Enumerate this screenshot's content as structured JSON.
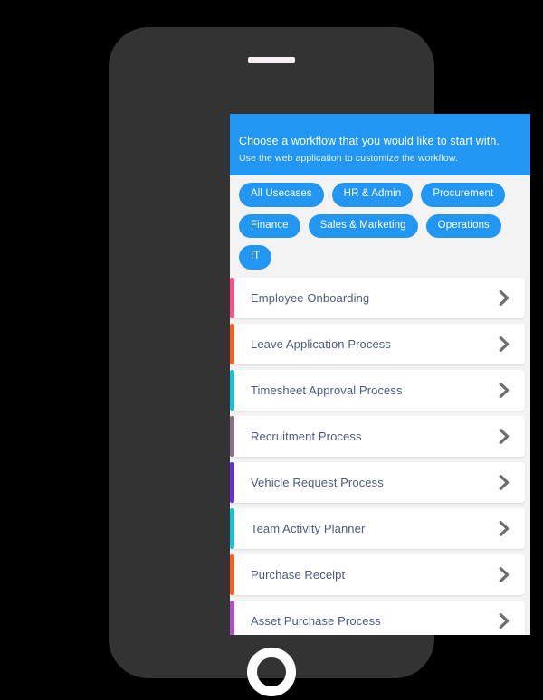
{
  "device": {
    "frame_color": "#333333",
    "speaker_slot_color": "#f7eef3",
    "home_button_color": "#ffffff"
  },
  "header": {
    "title": "Choose a workflow that you would like to start with.",
    "subtitle": "Use the web application to customize the workflow.",
    "background": "#2196f3"
  },
  "filters": {
    "chips": [
      {
        "label": "All Usecases"
      },
      {
        "label": "HR & Admin"
      },
      {
        "label": "Procurement"
      },
      {
        "label": "Finance"
      },
      {
        "label": "Sales & Marketing"
      },
      {
        "label": "Operations"
      },
      {
        "label": "IT"
      }
    ],
    "chip_color": "#2196f3"
  },
  "workflows": {
    "items": [
      {
        "label": "Employee Onboarding",
        "accent": "#f8528d",
        "chevron": "chevron-right-icon"
      },
      {
        "label": "Leave Application Process",
        "accent": "#f4601f",
        "chevron": "chevron-right-icon"
      },
      {
        "label": "Timesheet Approval Process",
        "accent": "#17c3d8",
        "chevron": "chevron-right-icon"
      },
      {
        "label": "Recruitment Process",
        "accent": "#8a6e84",
        "chevron": "chevron-right-icon"
      },
      {
        "label": "Vehicle Request Process",
        "accent": "#6633cc",
        "chevron": "chevron-right-icon"
      },
      {
        "label": "Team Activity Planner",
        "accent": "#17c3d8",
        "chevron": "chevron-right-icon"
      },
      {
        "label": "Purchase Receipt",
        "accent": "#f4601f",
        "chevron": "chevron-right-icon"
      },
      {
        "label": "Asset Purchase Process",
        "accent": "#b050c8",
        "chevron": "chevron-right-icon"
      },
      {
        "label": "",
        "accent": "#1e9fe8",
        "chevron": "chevron-right-icon"
      }
    ],
    "label_color": "#4c5c80",
    "card_background": "#ffffff",
    "list_background": "#f3f3f3"
  }
}
